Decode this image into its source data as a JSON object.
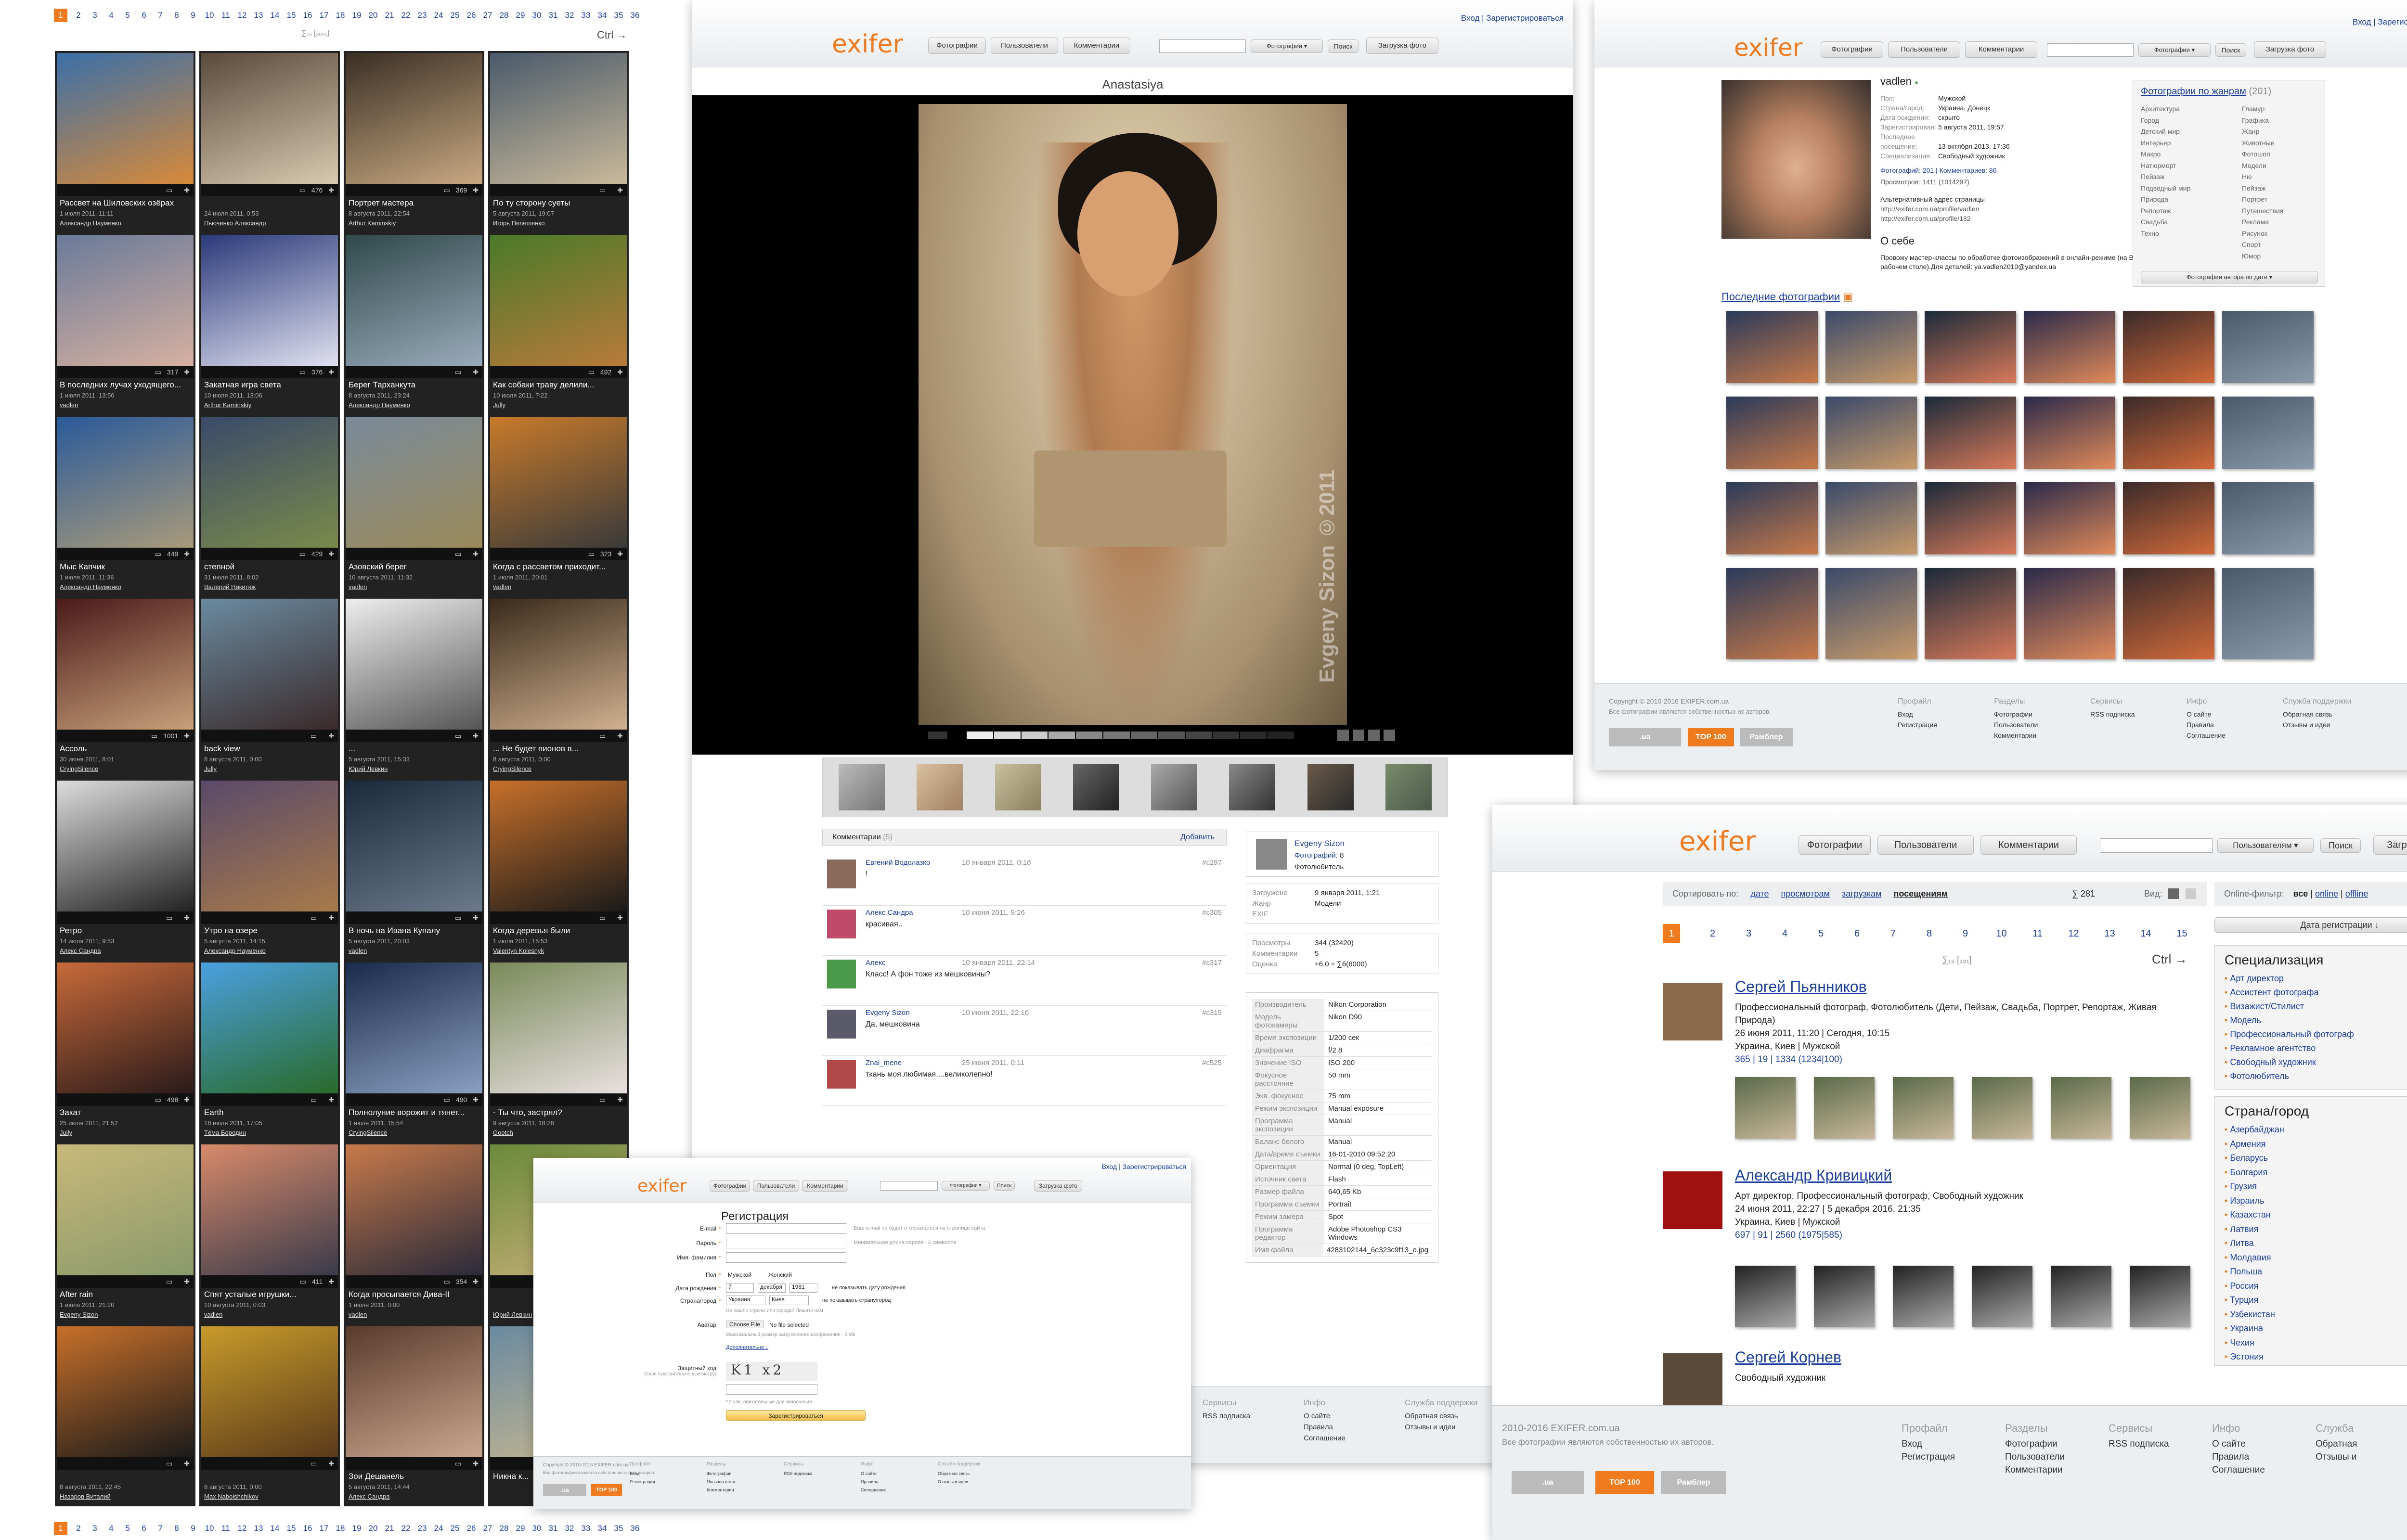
{
  "gallery": {
    "pager": [
      "1",
      "2",
      "3",
      "4",
      "5",
      "6",
      "7",
      "8",
      "9",
      "10",
      "11",
      "12",
      "13",
      "14",
      "15",
      "16",
      "17",
      "18",
      "19",
      "20",
      "21",
      "22",
      "23",
      "24",
      "25",
      "26",
      "27",
      "28",
      "29",
      "30",
      "31",
      "32",
      "33",
      "34",
      "35",
      "36"
    ],
    "summary": "∑₁₀ [₂₀₀₁]",
    "ctrl": "Ctrl →",
    "items": [
      {
        "title": "Рассвет на Шиловских озёрах",
        "date": "1 июля 2011, 11:11",
        "author": "Александр Науменко",
        "views": "",
        "c1": "#3a6fa8",
        "c2": "#d88a3a"
      },
      {
        "title": "",
        "date": "24 июля 2011, 0:53",
        "author": "Пьюченко Александр",
        "views": "476",
        "c1": "#5a4a3a",
        "c2": "#d9c9b0"
      },
      {
        "title": "Портрет мастера",
        "date": "8 августа 2011, 22:54",
        "author": "Arthur Kaminskiy",
        "views": "369",
        "c1": "#3a2f24",
        "c2": "#c8a882"
      },
      {
        "title": "По ту сторону суеты",
        "date": "5 августа 2011, 19:07",
        "author": "Игорь Пелешенко",
        "views": "",
        "c1": "#4a5a6a",
        "c2": "#c9b99a"
      },
      {
        "title": "В последних лучах уходящего...",
        "date": "1 июля 2011, 13:56",
        "author": "vadlen",
        "views": "317",
        "c1": "#6a7a9a",
        "c2": "#d6b0a0"
      },
      {
        "title": "Закатная игра света",
        "date": "10 июля 2011, 13:06",
        "author": "Arthur Kaminskiy",
        "views": "376",
        "c1": "#2a3a7a",
        "c2": "#e0e0f0"
      },
      {
        "title": "Берег Тарханкута",
        "date": "8 августа 2011, 23:24",
        "author": "Александр Науменко",
        "views": "",
        "c1": "#2f4a4a",
        "c2": "#9ab"
      },
      {
        "title": "Как собаки траву делили...",
        "date": "10 июля 2011, 7:22",
        "author": "Jully",
        "views": "492",
        "c1": "#4a7a2a",
        "c2": "#b87a3a"
      },
      {
        "title": "Мыс Капчик",
        "date": "1 июля 2011, 11:36",
        "author": "Александр Науменко",
        "views": "449",
        "c1": "#2a5a9a",
        "c2": "#a89a7a"
      },
      {
        "title": "степной",
        "date": "31 июля 2011, 8:02",
        "author": "Валерий Никитюк",
        "views": "429",
        "c1": "#3a4a6a",
        "c2": "#7a8a4a"
      },
      {
        "title": "Азовский берег",
        "date": "10 августа 2011, 11:32",
        "author": "vadlen",
        "views": "",
        "c1": "#7a8a9a",
        "c2": "#9a8a5a"
      },
      {
        "title": "Когда с рассветом приходит...",
        "date": "1 июля 2011, 20:01",
        "author": "vadlen",
        "views": "323",
        "c1": "#c87a2a",
        "c2": "#3a3a3a"
      },
      {
        "title": "Ассоль",
        "date": "30 июня 2011, 8:01",
        "author": "CryingSilence",
        "views": "1001",
        "c1": "#4a1a1a",
        "c2": "#c8a07a"
      },
      {
        "title": "back view",
        "date": "8 августа 2011, 0:00",
        "author": "Jully",
        "views": "",
        "c1": "#6a8aa0",
        "c2": "#3a2a2a"
      },
      {
        "title": "...",
        "date": "5 августа 2011, 15:33",
        "author": "Юрий Левкин",
        "views": "",
        "c1": "#eee",
        "c2": "#555"
      },
      {
        "title": "... Не будет пионов в...",
        "date": "8 августа 2011, 0:00",
        "author": "CryingSilence",
        "views": "",
        "c1": "#3a2a1a",
        "c2": "#d0b090"
      },
      {
        "title": "Ретро",
        "date": "14 июля 2011, 9:53",
        "author": "Алекс Сандра",
        "views": "",
        "c1": "#ddd",
        "c2": "#222"
      },
      {
        "title": "Утро на озере",
        "date": "5 августа 2011, 14:15",
        "author": "Александр Науменко",
        "views": "",
        "c1": "#5a4a6a",
        "c2": "#a87a4a"
      },
      {
        "title": "В ночь на Ивана Купалу",
        "date": "5 августа 2011, 20:03",
        "author": "vadlen",
        "views": "",
        "c1": "#1a2a3a",
        "c2": "#6a7a8a"
      },
      {
        "title": "Когда деревья были",
        "date": "1 июля 2011, 15:53",
        "author": "Valentyn Kolesnyk",
        "views": "",
        "c1": "#c8702a",
        "c2": "#1a1a1a"
      },
      {
        "title": "Закат",
        "date": "25 июля 2011, 21:52",
        "author": "Jully",
        "views": "498",
        "c1": "#c86a3a",
        "c2": "#2a1a1a"
      },
      {
        "title": "Earth",
        "date": "18 июля 2011, 17:05",
        "author": "Тёма Бородин",
        "views": "",
        "c1": "#4aa0e0",
        "c2": "#2a6a2a"
      },
      {
        "title": "Полнолуние ворожит и тянет...",
        "date": "1 июля 2011, 15:54",
        "author": "CryingSilence",
        "views": "490",
        "c1": "#1a2a4a",
        "c2": "#8aa0c0"
      },
      {
        "title": "- Ты что, застрял?",
        "date": "9 августа 2011, 18:28",
        "author": "Gootch",
        "views": "",
        "c1": "#7a8a5a",
        "c2": "#e8e0e0"
      },
      {
        "title": "After rain",
        "date": "1 июля 2011, 21:20",
        "author": "Evgeny Sizon",
        "views": "",
        "c1": "#c8b87a",
        "c2": "#8a9a6a"
      },
      {
        "title": "Спят усталые игрушки...",
        "date": "10 августа 2011, 0:03",
        "author": "vadlen",
        "views": "411",
        "c1": "#d88a6a",
        "c2": "#3a3a4a"
      },
      {
        "title": "Когда просыпается Дива-II",
        "date": "1 июля 2011, 0:00",
        "author": "vadlen",
        "views": "354",
        "c1": "#c87a4a",
        "c2": "#2a2a3a"
      },
      {
        "title": "",
        "date": "",
        "author": "Юрий Левкин",
        "views": "",
        "c1": "#6a8a3a",
        "c2": "#c8b07a"
      },
      {
        "title": "",
        "date": "8 августа 2011, 22:45",
        "author": "Назаров Виталий",
        "views": "",
        "c1": "#c8702a",
        "c2": "#1a1a1a"
      },
      {
        "title": "",
        "date": "8 августа 2011, 0:00",
        "author": "Max Naboishchikov",
        "views": "",
        "c1": "#c89a2a",
        "c2": "#5a3a1a"
      },
      {
        "title": "Зои Дешанель",
        "date": "5 августа 2011, 14:44",
        "author": "Алекс Сандра",
        "views": "",
        "c1": "#5a3a2a",
        "c2": "#c8a890"
      },
      {
        "title": "Никна к...",
        "date": "",
        "author": "",
        "views": "",
        "c1": "#6a8aa0",
        "c2": "#c8b890"
      }
    ]
  },
  "photo_page": {
    "toplinks": "Вход | Зарегистрироваться",
    "logo": "exifer",
    "nav": [
      "Фотографии",
      "Пользователи",
      "Комментарии"
    ],
    "search_placeholder": "",
    "search_select": "Фотографии ▾",
    "search_btn": "Поиск",
    "upload": "Загрузка фото",
    "title": "Anastasiya",
    "watermark": "Evgeny Sizon ©2011",
    "comments_header": "Комментарии",
    "comments_count": "(5)",
    "add": "Добавить",
    "comments": [
      {
        "user": "Евгений Водолазко",
        "date": "10 января 2011, 0:16",
        "text": "!",
        "id": "#c297"
      },
      {
        "user": "Алекс Сандра",
        "date": "10 июня 2011, 9:26",
        "text": "красивая..",
        "id": "#c305"
      },
      {
        "user": "Алекс",
        "date": "10 января 2011, 22:14",
        "text": "Класс! А фон тоже из мешковины?",
        "id": "#c317"
      },
      {
        "user": "Evgeny Sizon",
        "date": "10 июня 2011, 22:16",
        "text": "Да, мешковина",
        "id": "#c319"
      },
      {
        "user": "Znai_mene",
        "date": "25 июня 2011, 0:11",
        "text": "ткань моя любимая....великолепно!",
        "id": "#c525"
      }
    ],
    "author": {
      "name": "Evgeny Sizon",
      "photos_label": "Фотографий:",
      "photos": "8",
      "spec": "Фотолюбитель"
    },
    "info": [
      {
        "k": "Загружено",
        "v": "9 января 2011, 1:21"
      },
      {
        "k": "Жанр",
        "v": "Модели"
      },
      {
        "k": "EXIF",
        "v": ""
      }
    ],
    "stats": [
      {
        "k": "Просмотры",
        "v": "344 (32420)"
      },
      {
        "k": "Комментарии",
        "v": "5"
      },
      {
        "k": "Оценка",
        "v": "+6.0 ÷ ∑6(6000)"
      }
    ],
    "exif": [
      {
        "k": "Производитель",
        "v": "Nikon Corporation"
      },
      {
        "k": "Модель фотокамеры",
        "v": "Nikon D90"
      },
      {
        "k": "Время экспозиции",
        "v": "1/200 сек"
      },
      {
        "k": "Диафрагма",
        "v": "f/2.8"
      },
      {
        "k": "Значение ISO",
        "v": "ISO 200"
      },
      {
        "k": "Фокусное расстояние",
        "v": "50 mm"
      },
      {
        "k": "Экв. фокусное",
        "v": "75 mm"
      },
      {
        "k": "Режим экспозиции",
        "v": "Manual exposure"
      },
      {
        "k": "Программа экспозиции",
        "v": "Manual"
      },
      {
        "k": "Баланс белого",
        "v": "Manual"
      },
      {
        "k": "Дата/время съемки",
        "v": "16-01-2010 09:52:20"
      },
      {
        "k": "Ориентация",
        "v": "Normal (0 deg, TopLeft)"
      },
      {
        "k": "Источник света",
        "v": "Flash"
      },
      {
        "k": "Размер файла",
        "v": "640,65 Kb"
      },
      {
        "k": "Программа съемки",
        "v": "Portrait"
      },
      {
        "k": "Режим замера",
        "v": "Spot"
      },
      {
        "k": "Программа редактор",
        "v": "Adobe Photoshop CS3 Windows"
      },
      {
        "k": "Имя файла",
        "v": "4283102144_6e323c9f13_o.jpg"
      }
    ],
    "footer": [
      {
        "h": "Сервисы",
        "i": [
          "RSS подписка"
        ]
      },
      {
        "h": "Инфо",
        "i": [
          "О сайте",
          "Правила",
          "Соглашение"
        ]
      },
      {
        "h": "Служба поддержки",
        "i": [
          "Обратная связь",
          "Отзывы и идеи"
        ]
      }
    ]
  },
  "profile_page": {
    "toplinks": "Вход | Зарегистрироваться",
    "logo": "exifer",
    "nav": [
      "Фотографии",
      "Пользователи",
      "Комментарии"
    ],
    "search_select": "Фотографии ▾",
    "search_btn": "Поиск",
    "upload": "Загрузка фото",
    "name": "vadlen",
    "fields": [
      {
        "k": "Пол:",
        "v": "Мужской"
      },
      {
        "k": "Страна/город:",
        "v": "Украина, Донецк"
      },
      {
        "k": "Дата рождения:",
        "v": "скрыто"
      },
      {
        "k": "Зарегистрирован:",
        "v": "5 августа 2011, 19:57"
      },
      {
        "k": "Последнее посещение:",
        "v": "13 октября 2013, 17:36"
      },
      {
        "k": "Специализация:",
        "v": "Свободный художник"
      }
    ],
    "photos_line": "Фотографий: 201 | Комментариев: 86",
    "views_line": "Просмотров: 1411 (1014297)",
    "alt_addr": "Альтернативный адрес страницы",
    "alt1": "http://exifer.com.ua/profile/vadlen",
    "alt2": "http://exifer.com.ua/profile/182",
    "about_h": "О себе",
    "about": "Провожу мастер-классы по обработке фотоизображений в онлайн-режиме (на Вашем рабочем столе).Для деталей: ya.vadlen2010@yandex.ua",
    "genres_h": "Фотографии по жанрам",
    "genres_n": "(201)",
    "genres_l": [
      "Архитектура",
      "Город",
      "Детский мир",
      "Интерьер",
      "Макро",
      "Натюрморт",
      "Пейзаж",
      "Подводный мир",
      "Природа",
      "Репортаж",
      "Свадьба",
      "Техно"
    ],
    "genres_r": [
      "Гламур",
      "Графика",
      "Жанр",
      "Животные",
      "Фотошоп",
      "Модели",
      "Ню",
      "Пейзаж",
      "Портрет",
      "Путешествия",
      "Реклама",
      "Рисунок",
      "Спорт",
      "Юмор"
    ],
    "genres_btn": "Фотографии автора по дате ▾",
    "recent_h": "Последние фотографии",
    "copyright": "Copyright © 2010-2016 EXIFER.com.ua",
    "copyright2": "Все фотографии являются собственностью их авторов.",
    "footer": [
      {
        "h": "Профайл",
        "i": [
          "Вход",
          "Регистрация"
        ]
      },
      {
        "h": "Разделы",
        "i": [
          "Фотографии",
          "Пользователи",
          "Комментарии"
        ]
      },
      {
        "h": "Сервисы",
        "i": [
          "RSS подписка"
        ]
      },
      {
        "h": "Инфо",
        "i": [
          "О сайте",
          "Правила",
          "Соглашение"
        ]
      },
      {
        "h": "Служба поддержки",
        "i": [
          "Обратная связь",
          "Отзывы и идеи"
        ]
      }
    ]
  },
  "users_page": {
    "logo": "exifer",
    "nav": [
      "Фотографии",
      "Пользователи",
      "Комментарии"
    ],
    "search_select": "Пользователям ▾",
    "search_btn": "Поиск",
    "upload": "Загрузка фото",
    "sort_label": "Сортировать по:",
    "sort": [
      "дате",
      "просмотрам",
      "загрузкам",
      "посещениям"
    ],
    "count": "∑ 281",
    "view": "Вид:",
    "online_label": "Online-фильтр:",
    "online": [
      "все",
      "online",
      "offline"
    ],
    "reg_btn": "Дата регистрации ↓",
    "pager": [
      "1",
      "2",
      "3",
      "4",
      "5",
      "6",
      "7",
      "8",
      "9",
      "10",
      "11",
      "12",
      "13",
      "14",
      "15"
    ],
    "summary": "∑₁₅ [₂₈₁]",
    "ctrl": "Ctrl →",
    "users": [
      {
        "name": "Сергей Пьянников",
        "spec": "Профессиональный фотограф, Фотолюбитель (Дети, Пейзаж, Свадьба, Портрет, Репортаж, Живая Природа)",
        "reg": "26 июня 2011, 11:20",
        "last": "Сегодня, 10:15",
        "city": "Украина, Киев",
        "sex": "Мужской",
        "photos": "365",
        "comments": "19",
        "views": "1334 (1234|100)",
        "c": "#8a6a4a"
      },
      {
        "name": "Александр Кривицкий",
        "spec": "Арт директор, Профессиональный фотограф, Свободный художник",
        "reg": "24 июня 2011, 22:27",
        "last": "5 декабря 2016, 21:35",
        "city": "Украина, Киев",
        "sex": "Мужской",
        "photos": "697",
        "comments": "91",
        "views": "2560 (1975|585)",
        "c": "#a01010"
      },
      {
        "name": "Сергей Корнев",
        "spec": "Свободный художник",
        "reg": "",
        "last": "",
        "city": "",
        "sex": "",
        "photos": "",
        "comments": "",
        "views": "",
        "c": "#5a4a3a"
      }
    ],
    "spec_h": "Специализация",
    "spec": [
      "Арт директор",
      "Ассистент фотографа",
      "Визажист/Стилист",
      "Модель",
      "Профессиональный фотограф",
      "Рекламное агентство",
      "Свободный художник",
      "Фотолюбитель"
    ],
    "country_h": "Страна/город",
    "countries": [
      "Азербайджан",
      "Армения",
      "Беларусь",
      "Болгария",
      "Грузия",
      "Израиль",
      "Казахстан",
      "Латвия",
      "Литва",
      "Молдавия",
      "Польша",
      "Россия",
      "Турция",
      "Узбекистан",
      "Украина",
      "Чехия",
      "Эстония"
    ],
    "copyright": "2010-2016 EXIFER.com.ua",
    "copyright2": "Все фотографии являются собственностью их авторов.",
    "footer": [
      {
        "h": "Профайл",
        "i": [
          "Вход",
          "Регистрация"
        ]
      },
      {
        "h": "Разделы",
        "i": [
          "Фотографии",
          "Пользователи",
          "Комментарии"
        ]
      },
      {
        "h": "Сервисы",
        "i": [
          "RSS подписка"
        ]
      },
      {
        "h": "Инфо",
        "i": [
          "О сайте",
          "Правила",
          "Соглашение"
        ]
      },
      {
        "h": "Служба",
        "i": [
          "Обратная",
          "Отзывы и"
        ]
      }
    ]
  },
  "reg_page": {
    "toplinks": "Вход | Зарегистрироваться",
    "logo": "exifer",
    "nav": [
      "Фотографии",
      "Пользователи",
      "Комментарии"
    ],
    "search_select": "Фотографии ▾",
    "search_btn": "Поиск",
    "upload": "Загрузка фото",
    "title": "Регистрация",
    "fields": [
      {
        "k": "E-mail",
        "hint": "Ваш e-mail не будет отображаться на странице сайта"
      },
      {
        "k": "Пароль",
        "hint": "Минимальная длина пароля - 6 символов"
      },
      {
        "k": "Имя, фамилия",
        "hint": ""
      }
    ],
    "sex_label": "Пол",
    "sex": [
      "Мужской",
      "Женский"
    ],
    "bday_label": "Дата рождения",
    "bday": [
      "7",
      "декабря",
      "1981"
    ],
    "bday_hint": "не показывать дату рождения",
    "country_label": "Страна/город",
    "country": [
      "Украина",
      "Киев"
    ],
    "country_hint": "не показывать страну/город",
    "country_note": "Не нашли страны или города? Пишите нам",
    "avatar_label": "Аватар",
    "avatar_btn": "Choose File",
    "avatar_file": "No file selected",
    "avatar_hint": "Максимальный размер загружаемого изображения - 2 Mb",
    "more": "Дополнительно ↓",
    "captcha_label": "Защитный код",
    "captcha_sub": "(поле чувствительно к регистру)",
    "captcha": "K1 x2",
    "required": "* Поля, обязательные для заполнения",
    "submit": "Зарегистрироваться",
    "copyright": "Copyright © 2010-2016 EXIFER.com.ua",
    "copyright2": "Все фотографии являются собственностью их авторов.",
    "footer": [
      {
        "h": "Профайл",
        "i": [
          "Вход",
          "Регистрация"
        ]
      },
      {
        "h": "Разделы",
        "i": [
          "Фотографии",
          "Пользователи",
          "Комментарии"
        ]
      },
      {
        "h": "Сервисы",
        "i": [
          "RSS подписка"
        ]
      },
      {
        "h": "Инфо",
        "i": [
          "О сайте",
          "Правила",
          "Соглашение"
        ]
      },
      {
        "h": "Служба поддержки",
        "i": [
          "Обратная связь",
          "Отзывы и идеи"
        ]
      }
    ]
  },
  "colors": {
    "accent": "#f07a1e",
    "link": "#1a3fa0"
  }
}
